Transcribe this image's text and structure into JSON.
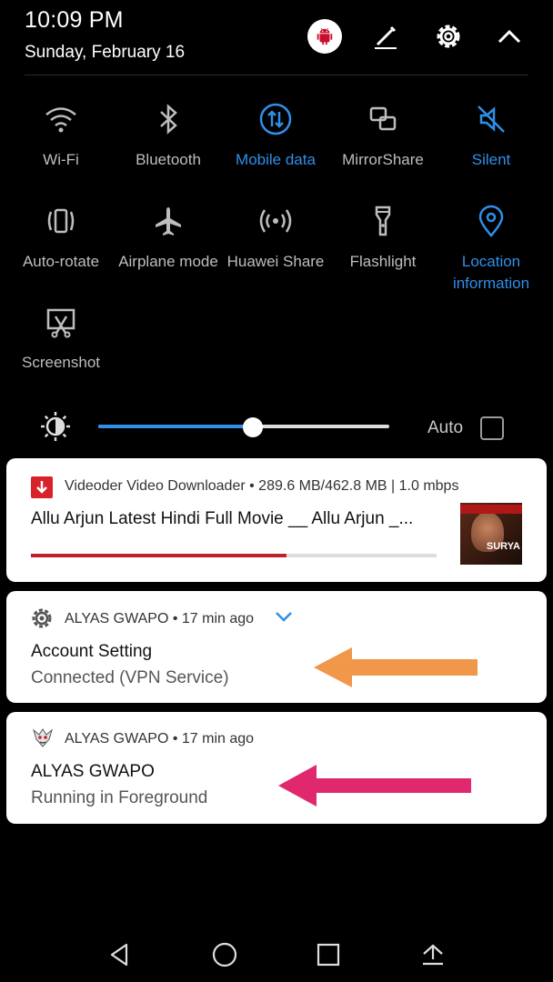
{
  "status": {
    "time": "10:09 PM",
    "date": "Sunday, February 16"
  },
  "header_icons": {
    "avatar": "android-robot-icon",
    "edit": "pencil-icon",
    "settings": "gear-icon",
    "collapse": "chevron-up-icon"
  },
  "tiles": [
    {
      "label": "Wi-Fi",
      "icon": "wifi-icon",
      "active": false
    },
    {
      "label": "Bluetooth",
      "icon": "bluetooth-icon",
      "active": false
    },
    {
      "label": "Mobile data",
      "icon": "mobile-data-icon",
      "active": true
    },
    {
      "label": "MirrorShare",
      "icon": "mirrorshare-icon",
      "active": false
    },
    {
      "label": "Silent",
      "icon": "silent-icon",
      "active": true
    },
    {
      "label": "Auto-rotate",
      "icon": "auto-rotate-icon",
      "active": false
    },
    {
      "label": "Airplane mode",
      "icon": "airplane-icon",
      "active": false
    },
    {
      "label": "Huawei Share",
      "icon": "huawei-share-icon",
      "active": false
    },
    {
      "label": "Flashlight",
      "icon": "flashlight-icon",
      "active": false
    },
    {
      "label_line1": "Location",
      "label_line2": "information",
      "icon": "location-icon",
      "active": true
    },
    {
      "label": "Screenshot",
      "icon": "screenshot-icon",
      "active": false
    }
  ],
  "brightness": {
    "level": 0.53,
    "auto_label": "Auto",
    "auto_checked": false
  },
  "notifications": [
    {
      "app": "Videoder Video Downloader",
      "meta": "289.6 MB/462.8 MB | 1.0 mbps",
      "title": "Allu Arjun Latest Hindi Full Movie __ Allu Arjun _...",
      "progress": 0.63,
      "thumb_text": "SURYA"
    },
    {
      "app": "ALYAS GWAPO",
      "time": "17 min ago",
      "title": "Account Setting",
      "subtitle": "Connected (VPN Service)",
      "arrow_color": "#f0974a"
    },
    {
      "app": "ALYAS GWAPO",
      "time": "17 min ago",
      "title": "ALYAS GWAPO",
      "subtitle": "Running in Foreground",
      "arrow_color": "#e0286e"
    }
  ],
  "colors": {
    "accent": "#2f8fe9",
    "download_red": "#c0202a"
  },
  "nav_icons": [
    "back-icon",
    "home-icon",
    "recents-icon",
    "hide-bar-icon"
  ]
}
